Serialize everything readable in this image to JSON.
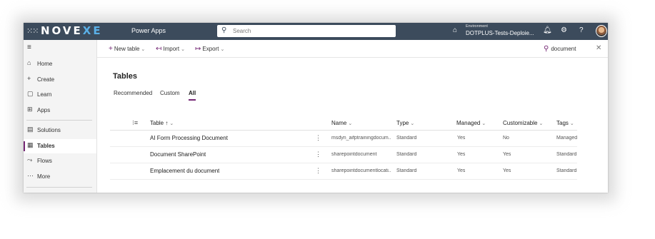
{
  "topbar": {
    "logo_a": "NOVE",
    "logo_b": "XE",
    "app_name": "Power Apps",
    "search_placeholder": "Search",
    "environment_label": "Environment",
    "environment_value": "DOTPLUS-Tests-Deploie..."
  },
  "sidebar": {
    "items": [
      {
        "label": "Home",
        "icon": "home-icon"
      },
      {
        "label": "Create",
        "icon": "plus-icon"
      },
      {
        "label": "Learn",
        "icon": "book-icon"
      },
      {
        "label": "Apps",
        "icon": "apps-icon"
      },
      {
        "label": "Solutions",
        "icon": "solutions-icon"
      },
      {
        "label": "Tables",
        "icon": "table-icon"
      },
      {
        "label": "Flows",
        "icon": "flow-icon"
      },
      {
        "label": "More",
        "icon": "more-icon"
      }
    ]
  },
  "commandbar": {
    "new_table": "New table",
    "import": "Import",
    "export": "Export",
    "search_value": "document"
  },
  "main": {
    "heading": "Tables",
    "tabs": [
      "Recommended",
      "Custom",
      "All"
    ],
    "columns": {
      "table": "Table",
      "name": "Name",
      "type": "Type",
      "managed": "Managed",
      "customizable": "Customizable",
      "tags": "Tags"
    },
    "rows": [
      {
        "table": "AI Form Processing Document",
        "name": "msdyn_aifptrainingdocum...",
        "type": "Standard",
        "managed": "Yes",
        "customizable": "No",
        "tags": "Managed"
      },
      {
        "table": "Document SharePoint",
        "name": "sharepointdocument",
        "type": "Standard",
        "managed": "Yes",
        "customizable": "Yes",
        "tags": "Standard"
      },
      {
        "table": "Emplacement du document",
        "name": "sharepointdocumentlocati...",
        "type": "Standard",
        "managed": "Yes",
        "customizable": "Yes",
        "tags": "Standard"
      }
    ]
  },
  "colors": {
    "topbar": "#3c4b5c",
    "accent": "#742774",
    "logo_accent": "#5ab0e8"
  }
}
